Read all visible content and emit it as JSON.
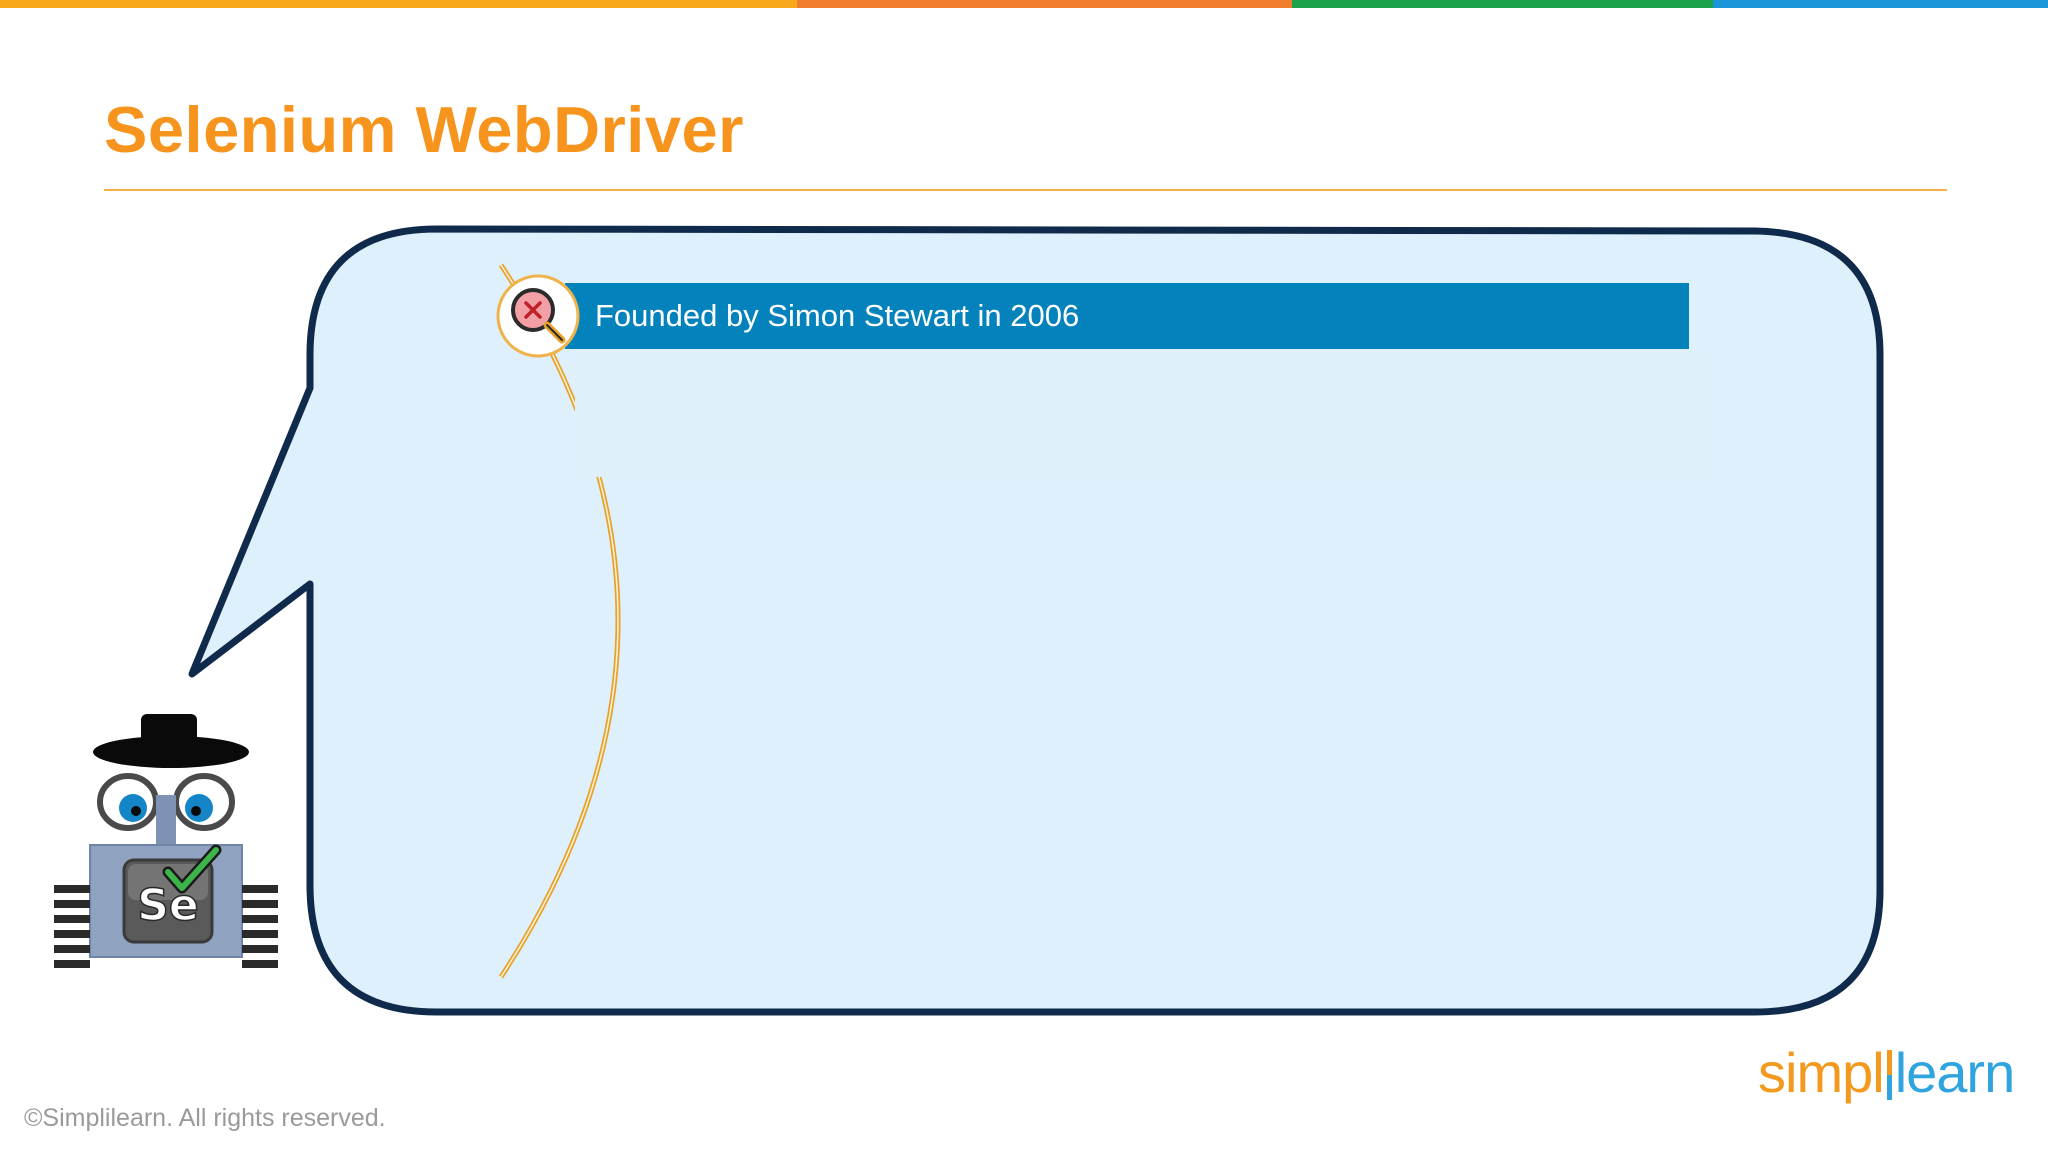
{
  "slide": {
    "title": "Selenium WebDriver",
    "bullet_1": "Founded by Simon Stewart in 2006",
    "copyright": "©Simplilearn. All rights reserved."
  },
  "brand": {
    "logo_part_1": "simpl",
    "logo_part_2": "learn",
    "top_bar_colors": [
      "#F7A81B",
      "#EF7D2D",
      "#1BA24A",
      "#1B95D8"
    ]
  },
  "colors": {
    "title": "#F7941D",
    "bubble_fill": "#DDF0FB",
    "bubble_stroke": "#0F2A4A",
    "banner": "#0482BC",
    "arc": "#E8A22C"
  },
  "icons": {
    "bullet_icon": "search-error-icon",
    "mascot": "selenium-robot-spy-icon"
  }
}
